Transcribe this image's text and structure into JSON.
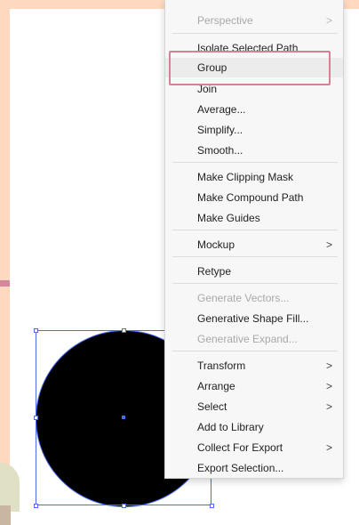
{
  "menu": {
    "items": [
      {
        "label": "Perspective",
        "disabled": true,
        "submenu": true
      },
      {
        "label": "Isolate Selected Path",
        "disabled": false,
        "submenu": false
      },
      {
        "label": "Group",
        "disabled": false,
        "submenu": false,
        "highlighted": true
      },
      {
        "label": "Join",
        "disabled": false,
        "submenu": false
      },
      {
        "label": "Average...",
        "disabled": false,
        "submenu": false
      },
      {
        "label": "Simplify...",
        "disabled": false,
        "submenu": false
      },
      {
        "label": "Smooth...",
        "disabled": false,
        "submenu": false
      },
      {
        "label": "Make Clipping Mask",
        "disabled": false,
        "submenu": false
      },
      {
        "label": "Make Compound Path",
        "disabled": false,
        "submenu": false
      },
      {
        "label": "Make Guides",
        "disabled": false,
        "submenu": false
      },
      {
        "label": "Mockup",
        "disabled": false,
        "submenu": true
      },
      {
        "label": "Retype",
        "disabled": false,
        "submenu": false
      },
      {
        "label": "Generate Vectors...",
        "disabled": true,
        "submenu": false
      },
      {
        "label": "Generative Shape Fill...",
        "disabled": false,
        "submenu": false
      },
      {
        "label": "Generative Expand...",
        "disabled": true,
        "submenu": false
      },
      {
        "label": "Transform",
        "disabled": false,
        "submenu": true
      },
      {
        "label": "Arrange",
        "disabled": false,
        "submenu": true
      },
      {
        "label": "Select",
        "disabled": false,
        "submenu": true
      },
      {
        "label": "Add to Library",
        "disabled": false,
        "submenu": false
      },
      {
        "label": "Collect For Export",
        "disabled": false,
        "submenu": true
      },
      {
        "label": "Export Selection...",
        "disabled": false,
        "submenu": false
      }
    ],
    "submenu_glyph": ">"
  },
  "colors": {
    "selection": "#4b6cf0",
    "highlight_frame": "#d77f93",
    "background": "#ffd9bf"
  }
}
